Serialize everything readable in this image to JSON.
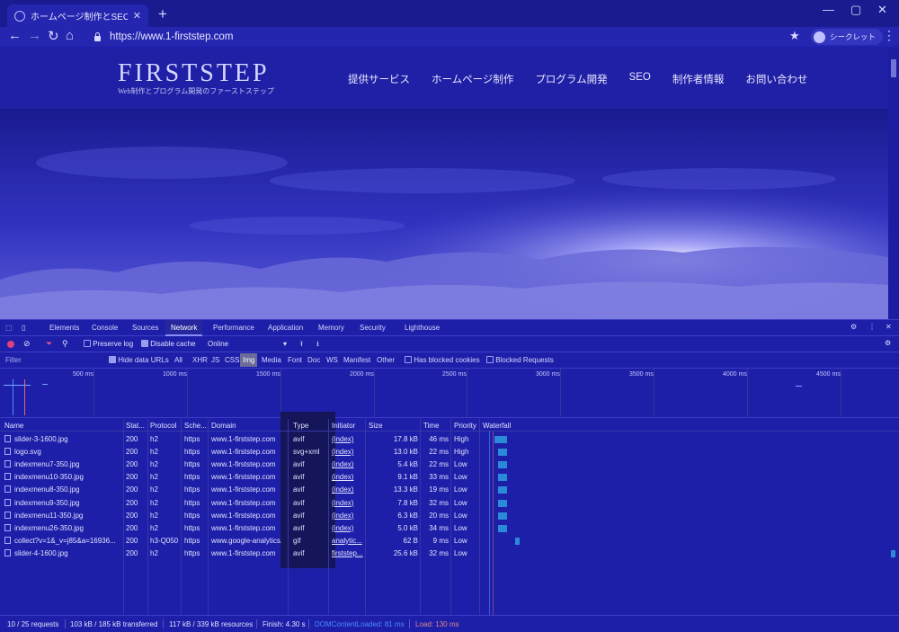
{
  "browser": {
    "tab_title": "ホームページ制作とSEO対策な",
    "url": "https://www.1-firststep.com",
    "incognito_label": "シークレット"
  },
  "site": {
    "logo": "FIRSTSTEP",
    "tagline": "Web制作とプログラム開発のファーストステップ",
    "nav": [
      "提供サービス",
      "ホームページ制作",
      "プログラム開発",
      "SEO",
      "制作者情報",
      "お問い合わせ"
    ]
  },
  "devtools": {
    "tabs": [
      "Elements",
      "Console",
      "Sources",
      "Network",
      "Performance",
      "Application",
      "Memory",
      "Security",
      "Lighthouse"
    ],
    "active_tab": "Network",
    "controls": {
      "preserve_log": "Preserve log",
      "disable_cache": "Disable cache",
      "throttle": "Online"
    },
    "filter": {
      "placeholder": "Filter",
      "hide_data_urls": "Hide data URLs",
      "types": [
        "All",
        "XHR",
        "JS",
        "CSS",
        "Img",
        "Media",
        "Font",
        "Doc",
        "WS",
        "Manifest",
        "Other"
      ],
      "active_type": "Img",
      "has_blocked_cookies": "Has blocked cookies",
      "blocked_requests": "Blocked Requests"
    },
    "timeline_ticks": [
      "500 ms",
      "1000 ms",
      "1500 ms",
      "2000 ms",
      "2500 ms",
      "3000 ms",
      "3500 ms",
      "4000 ms",
      "4500 ms"
    ],
    "columns": [
      "Name",
      "Stat...",
      "Protocol",
      "Sche...",
      "Domain",
      "Type",
      "Initiator",
      "Size",
      "Time",
      "Priority",
      "Waterfall"
    ],
    "rows": [
      {
        "name": "slider-3-1600.jpg",
        "status": "200",
        "protocol": "h2",
        "scheme": "https",
        "domain": "www.1-firststep.com",
        "type": "avif",
        "initiator": "(index)",
        "size": "17.8 kB",
        "time": "46 ms",
        "priority": "High",
        "wf_start": 0.03,
        "wf_len": 0.03
      },
      {
        "name": "logo.svg",
        "status": "200",
        "protocol": "h2",
        "scheme": "https",
        "domain": "www.1-firststep.com",
        "type": "svg+xml",
        "initiator": "(index)",
        "size": "13.0 kB",
        "time": "22 ms",
        "priority": "High",
        "wf_start": 0.04,
        "wf_len": 0.02
      },
      {
        "name": "indexmenu7-350.jpg",
        "status": "200",
        "protocol": "h2",
        "scheme": "https",
        "domain": "www.1-firststep.com",
        "type": "avif",
        "initiator": "(index)",
        "size": "5.4 kB",
        "time": "22 ms",
        "priority": "Low",
        "wf_start": 0.04,
        "wf_len": 0.02
      },
      {
        "name": "indexmenu10-350.jpg",
        "status": "200",
        "protocol": "h2",
        "scheme": "https",
        "domain": "www.1-firststep.com",
        "type": "avif",
        "initiator": "(index)",
        "size": "9.1 kB",
        "time": "33 ms",
        "priority": "Low",
        "wf_start": 0.04,
        "wf_len": 0.02
      },
      {
        "name": "indexmenu8-350.jpg",
        "status": "200",
        "protocol": "h2",
        "scheme": "https",
        "domain": "www.1-firststep.com",
        "type": "avif",
        "initiator": "(index)",
        "size": "13.3 kB",
        "time": "19 ms",
        "priority": "Low",
        "wf_start": 0.04,
        "wf_len": 0.02
      },
      {
        "name": "indexmenu9-350.jpg",
        "status": "200",
        "protocol": "h2",
        "scheme": "https",
        "domain": "www.1-firststep.com",
        "type": "avif",
        "initiator": "(index)",
        "size": "7.8 kB",
        "time": "32 ms",
        "priority": "Low",
        "wf_start": 0.04,
        "wf_len": 0.02
      },
      {
        "name": "indexmenu11-350.jpg",
        "status": "200",
        "protocol": "h2",
        "scheme": "https",
        "domain": "www.1-firststep.com",
        "type": "avif",
        "initiator": "(index)",
        "size": "6.3 kB",
        "time": "20 ms",
        "priority": "Low",
        "wf_start": 0.04,
        "wf_len": 0.02
      },
      {
        "name": "indexmenu26-350.jpg",
        "status": "200",
        "protocol": "h2",
        "scheme": "https",
        "domain": "www.1-firststep.com",
        "type": "avif",
        "initiator": "(index)",
        "size": "5.0 kB",
        "time": "34 ms",
        "priority": "Low",
        "wf_start": 0.04,
        "wf_len": 0.02
      },
      {
        "name": "collect?v=1&_v=j85&a=16936...",
        "status": "200",
        "protocol": "h3-Q050",
        "scheme": "https",
        "domain": "www.google-analytics...",
        "type": "gif",
        "initiator": "analytic...",
        "size": "62 B",
        "time": "9 ms",
        "priority": "Low",
        "wf_start": 0.08,
        "wf_len": 0.01
      },
      {
        "name": "slider-4-1600.jpg",
        "status": "200",
        "protocol": "h2",
        "scheme": "https",
        "domain": "www.1-firststep.com",
        "type": "avif",
        "initiator": "firststep...",
        "size": "25.6 kB",
        "time": "32 ms",
        "priority": "Low",
        "wf_start": 0.985,
        "wf_len": 0.01
      }
    ],
    "status": {
      "requests": "10 / 25 requests",
      "transferred": "103 kB / 185 kB transferred",
      "resources": "117 kB / 339 kB resources",
      "finish": "Finish: 4.30 s",
      "dom_loaded": "DOMContentLoaded: 81 ms",
      "load": "Load: 130 ms"
    },
    "colors": {
      "dom_loaded": "#4a8cff",
      "load": "#e06a6a",
      "waterfall_bar": "#2a8ad8"
    }
  }
}
